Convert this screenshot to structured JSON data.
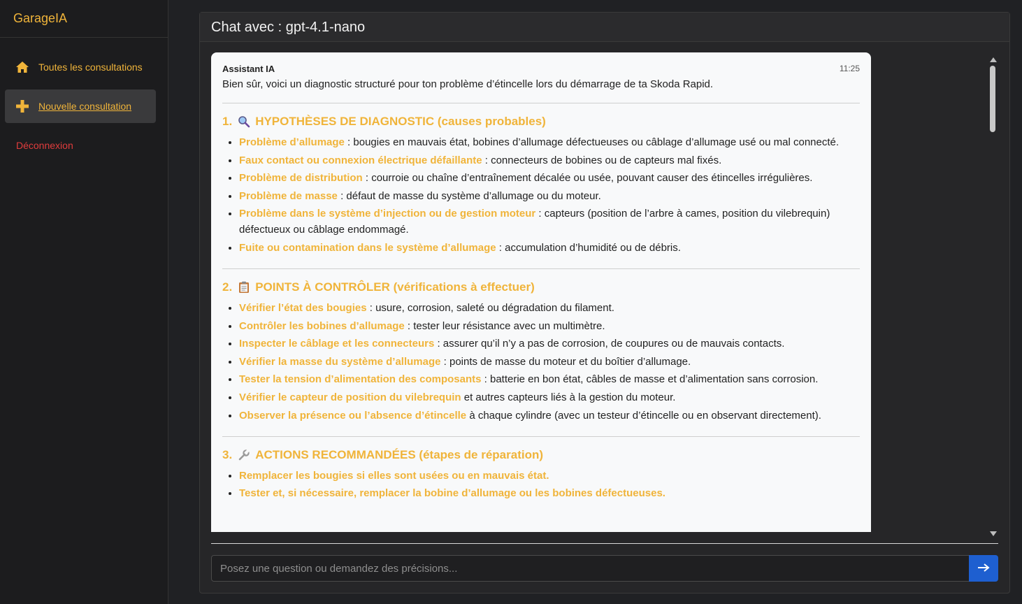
{
  "sidebar": {
    "brand": "GarageIA",
    "items": [
      {
        "label": "Toutes les consultations",
        "icon": "home-icon"
      },
      {
        "label": "Nouvelle consultation",
        "icon": "plus-icon"
      }
    ],
    "logout": "Déconnexion"
  },
  "header": {
    "title": "Chat avec : gpt-4.1-nano"
  },
  "message": {
    "author": "Assistant IA",
    "time": "11:25",
    "intro": "Bien sûr, voici un diagnostic structuré pour ton problème d’étincelle lors du démarrage de ta Skoda Rapid.",
    "sections": [
      {
        "number": "1.",
        "icon": "magnifier-icon",
        "title": "HYPOTHÈSES DE DIAGNOSTIC (causes probables)",
        "items": [
          {
            "label": "Problème d’allumage",
            "text": " : bougies en mauvais état, bobines d’allumage défectueuses ou câblage d’allumage usé ou mal connecté."
          },
          {
            "label": "Faux contact ou connexion électrique défaillante",
            "text": " : connecteurs de bobines ou de capteurs mal fixés."
          },
          {
            "label": "Problème de distribution",
            "text": " : courroie ou chaîne d’entraînement décalée ou usée, pouvant causer des étincelles irrégulières."
          },
          {
            "label": "Problème de masse",
            "text": " : défaut de masse du système d’allumage ou du moteur."
          },
          {
            "label": "Problème dans le système d’injection ou de gestion moteur",
            "text": " : capteurs (position de l’arbre à cames, position du vilebrequin) défectueux ou câblage endommagé."
          },
          {
            "label": "Fuite ou contamination dans le système d’allumage",
            "text": " : accumulation d’humidité ou de débris."
          }
        ]
      },
      {
        "number": "2.",
        "icon": "clipboard-icon",
        "title": "POINTS À CONTRÔLER (vérifications à effectuer)",
        "items": [
          {
            "label": "Vérifier l’état des bougies",
            "text": " : usure, corrosion, saleté ou dégradation du filament."
          },
          {
            "label": "Contrôler les bobines d’allumage",
            "text": " : tester leur résistance avec un multimètre."
          },
          {
            "label": "Inspecter le câblage et les connecteurs",
            "text": " : assurer qu’il n’y a pas de corrosion, de coupures ou de mauvais contacts."
          },
          {
            "label": "Vérifier la masse du système d’allumage",
            "text": " : points de masse du moteur et du boîtier d’allumage."
          },
          {
            "label": "Tester la tension d’alimentation des composants",
            "text": " : batterie en bon état, câbles de masse et d’alimentation sans corrosion."
          },
          {
            "label": "Vérifier le capteur de position du vilebrequin",
            "text": " et autres capteurs liés à la gestion du moteur."
          },
          {
            "label": "Observer la présence ou l’absence d’étincelle",
            "text": " à chaque cylindre (avec un testeur d’étincelle ou en observant directement)."
          }
        ]
      },
      {
        "number": "3.",
        "icon": "wrench-icon",
        "title": "ACTIONS RECOMMANDÉES (étapes de réparation)",
        "items": [
          {
            "label": "Remplacer les bougies si elles sont usées ou en mauvais état.",
            "text": ""
          },
          {
            "label": "Tester et, si nécessaire, remplacer la bobine d’allumage ou les bobines défectueuses.",
            "text": ""
          }
        ]
      }
    ]
  },
  "input": {
    "placeholder": "Posez une question ou demandez des précisions..."
  },
  "colors": {
    "accent": "#f0b43a",
    "send": "#1e5fd0",
    "logout": "#e03c3c"
  }
}
